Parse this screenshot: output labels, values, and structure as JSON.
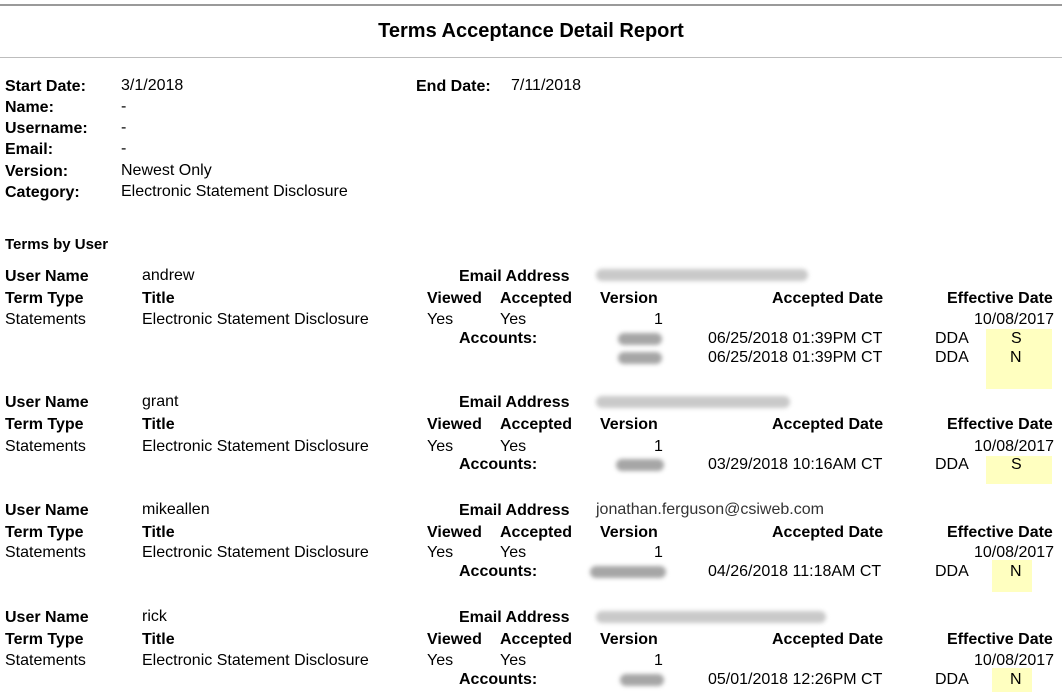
{
  "report": {
    "title": "Terms Acceptance Detail Report"
  },
  "criteria": {
    "start_date_label": "Start Date:",
    "start_date": "3/1/2018",
    "end_date_label": "End Date:",
    "end_date": "7/11/2018",
    "name_label": "Name:",
    "name": "-",
    "username_label": "Username:",
    "username": "-",
    "email_label": "Email:",
    "email": "-",
    "version_label": "Version:",
    "version": "Newest Only",
    "category_label": "Category:",
    "category": "Electronic Statement Disclosure"
  },
  "section_title": "Terms by User",
  "labels": {
    "user_name": "User Name",
    "email_address": "Email Address",
    "term_type": "Term Type",
    "title": "Title",
    "viewed": "Viewed",
    "accepted": "Accepted",
    "version": "Version",
    "accepted_date": "Accepted Date",
    "effective_date": "Effective Date",
    "accounts": "Accounts:"
  },
  "users": [
    {
      "user_name": "andrew",
      "term_type": "Statements",
      "title": "Electronic Statement Disclosure",
      "viewed": "Yes",
      "accepted": "Yes",
      "version": "1",
      "effective_date": "10/08/2017",
      "accounts": [
        {
          "accepted_date": "06/25/2018 01:39PM CT",
          "type": "DDA",
          "flag": "S"
        },
        {
          "accepted_date": "06/25/2018 01:39PM CT",
          "type": "DDA",
          "flag": "N"
        }
      ]
    },
    {
      "user_name": "grant",
      "term_type": "Statements",
      "title": "Electronic Statement Disclosure",
      "viewed": "Yes",
      "accepted": "Yes",
      "version": "1",
      "effective_date": "10/08/2017",
      "accounts": [
        {
          "accepted_date": "03/29/2018 10:16AM CT",
          "type": "DDA",
          "flag": "S"
        }
      ]
    },
    {
      "user_name": "mikeallen",
      "email": "jonathan.ferguson@csiweb.com",
      "term_type": "Statements",
      "title": "Electronic Statement Disclosure",
      "viewed": "Yes",
      "accepted": "Yes",
      "version": "1",
      "effective_date": "10/08/2017",
      "accounts": [
        {
          "accepted_date": "04/26/2018 11:18AM CT",
          "type": "DDA",
          "flag": "N"
        }
      ]
    },
    {
      "user_name": "rick",
      "term_type": "Statements",
      "title": "Electronic Statement Disclosure",
      "viewed": "Yes",
      "accepted": "Yes",
      "version": "1",
      "effective_date": "10/08/2017",
      "accounts": [
        {
          "accepted_date": "05/01/2018 12:26PM CT",
          "type": "DDA",
          "flag": "N"
        }
      ]
    }
  ],
  "colors": {
    "highlight": "#ffffc0",
    "rule": "#9a9a9a"
  }
}
